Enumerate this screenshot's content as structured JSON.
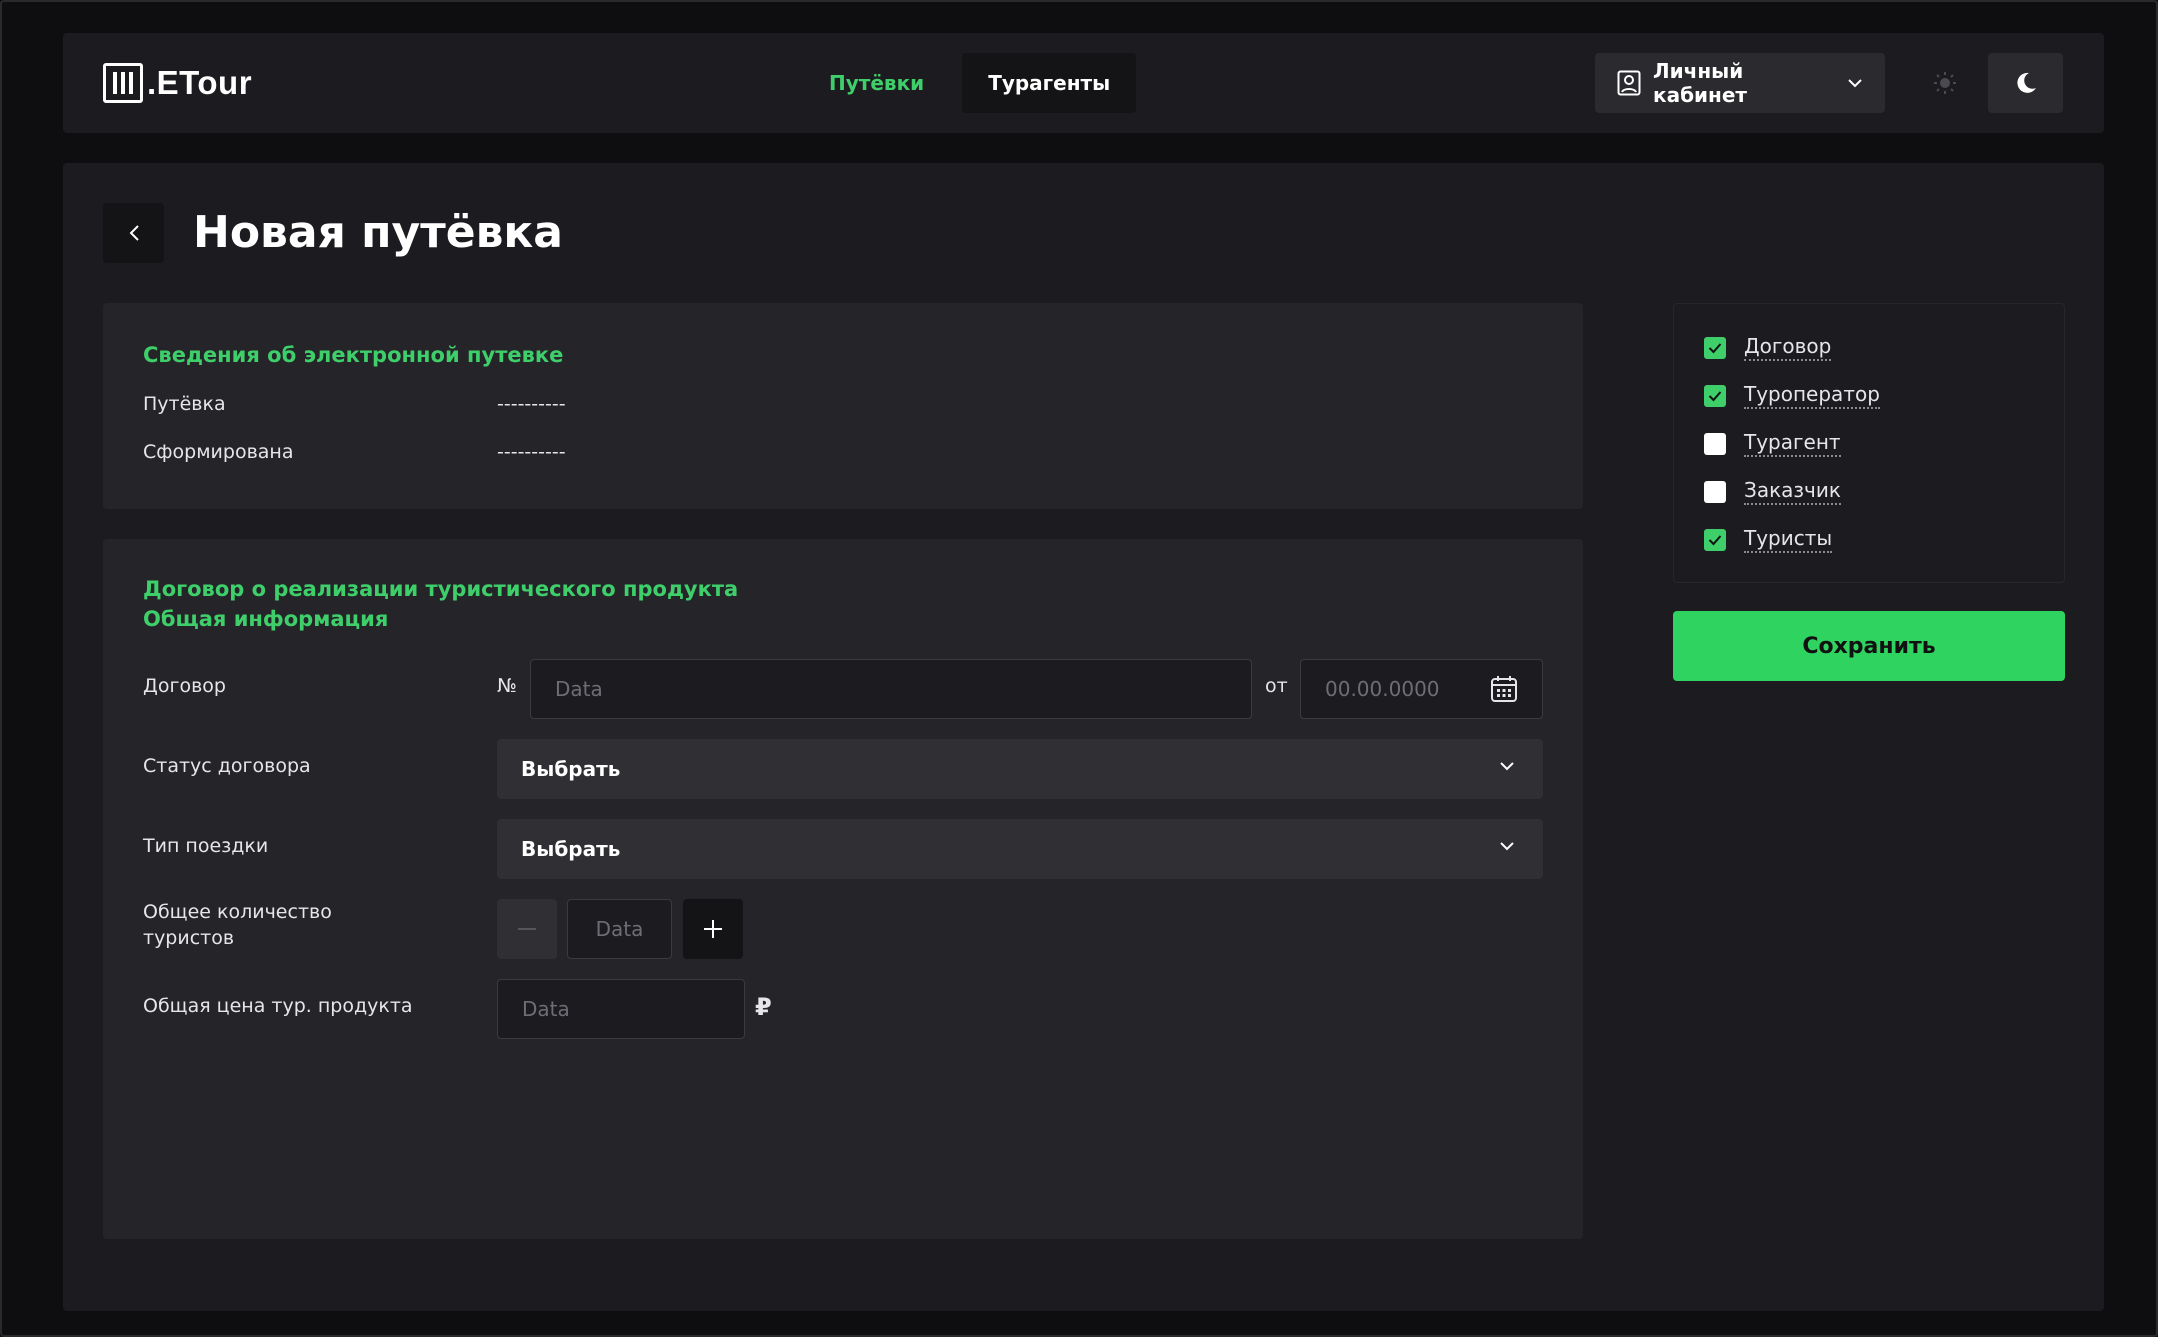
{
  "header": {
    "logo_text": ".ETour",
    "nav": [
      {
        "label": "Путёвки",
        "active": true
      },
      {
        "label": "Турагенты",
        "active": false
      }
    ],
    "account_label": "Личный кабинет"
  },
  "page": {
    "title": "Новая путёвка"
  },
  "info_card": {
    "title": "Сведения об электронной путевке",
    "rows": [
      {
        "label": "Путёвка",
        "value": "----------"
      },
      {
        "label": "Сформирована",
        "value": "----------"
      }
    ]
  },
  "contract_card": {
    "title_line1": "Договор о реализации туристического продукта",
    "title_line2": "Общая информация",
    "contract": {
      "label": "Договор",
      "number_sign": "№",
      "number_placeholder": "Data",
      "date_prefix": "от",
      "date_placeholder": "00.00.0000"
    },
    "status": {
      "label": "Статус договора",
      "value": "Выбрать"
    },
    "trip_type": {
      "label": "Тип поездки",
      "value": "Выбрать"
    },
    "tourists": {
      "label_line1": "Общее количество",
      "label_line2": "туристов",
      "placeholder": "Data"
    },
    "price": {
      "label": "Общая цена тур. продукта",
      "placeholder": "Data",
      "currency": "₽"
    }
  },
  "sections": [
    {
      "label": "Договор",
      "checked": true
    },
    {
      "label": "Туроператор",
      "checked": true
    },
    {
      "label": "Турагент",
      "checked": false
    },
    {
      "label": "Заказчик",
      "checked": false
    },
    {
      "label": "Туристы",
      "checked": true
    }
  ],
  "save_label": "Сохранить",
  "colors": {
    "accent": "#3ecf6b",
    "background": "#0e0e10",
    "panel": "#1c1c20",
    "card": "#252529"
  },
  "icons": [
    "logo-icon",
    "user-icon",
    "chevron-down-icon",
    "sun-icon",
    "moon-icon",
    "chevron-left-icon",
    "calendar-icon",
    "minus-icon",
    "plus-icon",
    "check-icon"
  ]
}
